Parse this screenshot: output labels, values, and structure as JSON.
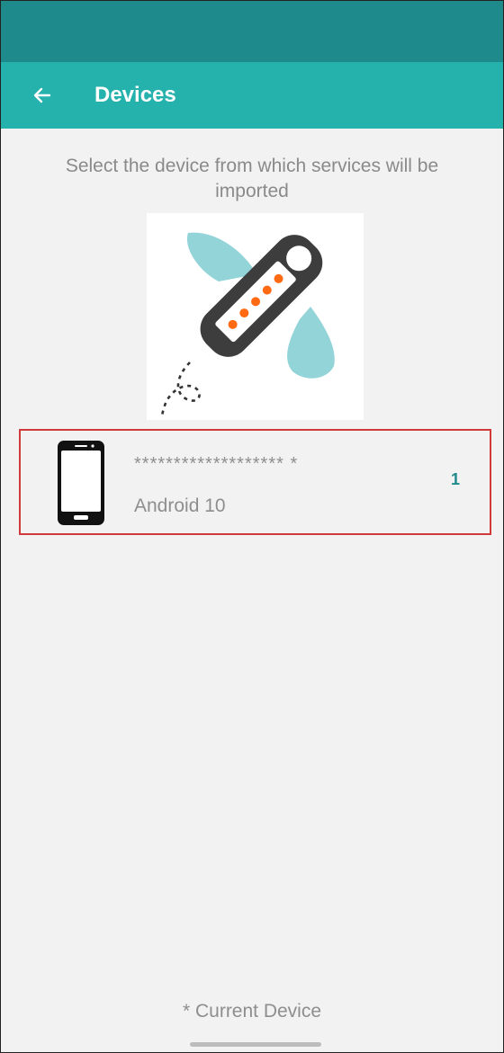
{
  "header": {
    "title": "Devices",
    "back_icon": "arrow-left-icon"
  },
  "main": {
    "subtitle": "Select the device from which services will be imported",
    "illustration_icon": "usb-key-icon",
    "devices": [
      {
        "name": "******************* *",
        "os": "Android 10",
        "badge": "1",
        "icon": "smartphone-icon"
      }
    ],
    "footer_note": "* Current Device"
  },
  "colors": {
    "status_bar": "#1f8a8c",
    "app_bar": "#25b2ad",
    "selection_border": "#d23a3a",
    "badge": "#1f8a8c",
    "illustration_dots": "#ff6a13",
    "illustration_drops": "#93d4d9"
  }
}
